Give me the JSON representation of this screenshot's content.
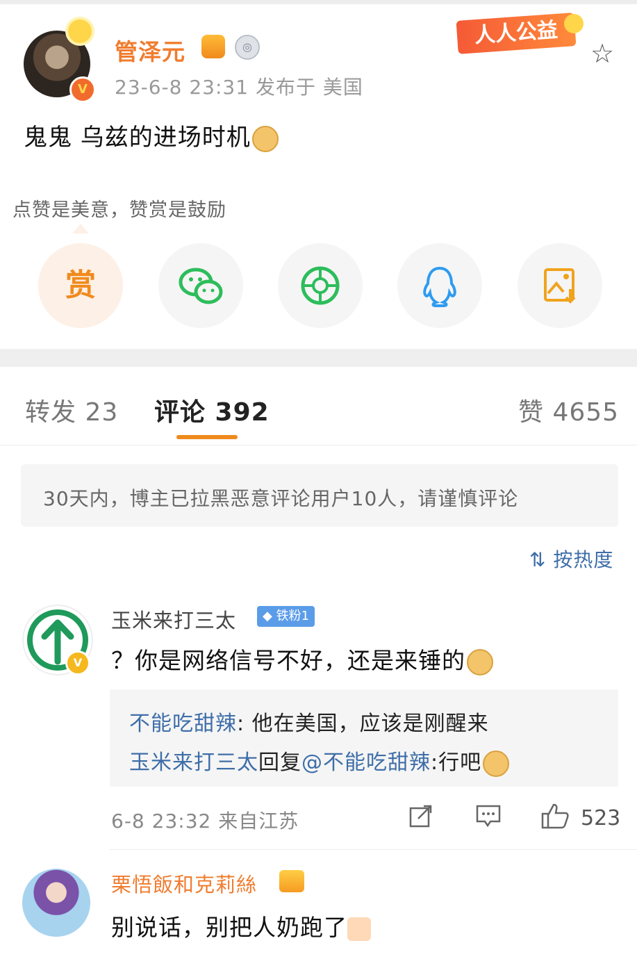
{
  "post": {
    "author": "管泽元",
    "time_location": "23-6-8 23:31  发布于 美国",
    "content": "鬼鬼 乌兹的进场时机",
    "charity_tag": "人人公益",
    "vip_letter": "V"
  },
  "reward_tip": "点赞是美意，赞赏是鼓励",
  "share_buttons": [
    {
      "icon": "reward-icon",
      "label": "赏"
    },
    {
      "icon": "wechat-icon"
    },
    {
      "icon": "moments-icon"
    },
    {
      "icon": "qq-icon"
    },
    {
      "icon": "save-image-icon"
    }
  ],
  "tabs": {
    "repost": "转发 23",
    "comments": "评论 392",
    "likes": "赞 4655"
  },
  "notice": "30天内，博主已拉黑恶意评论用户10人，请谨慎评论",
  "sort_label": "按热度",
  "comments": [
    {
      "user": "玉米来打三太",
      "fan_badge": "铁粉1",
      "vip_letter": "V",
      "text": "？你是网络信号不好，还是来锤的",
      "replies": [
        {
          "name": "不能吃甜辣",
          "sep": ": ",
          "text": "他在美国，应该是刚醒来"
        },
        {
          "name": "玉米来打三太",
          "mid": "回复",
          "mention": "@不能吃甜辣",
          "sep": ":",
          "text": "行吧"
        }
      ],
      "meta": "6-8 23:32  来自江苏",
      "likes": "523"
    },
    {
      "user": "栗悟飯和克莉絲",
      "text": "别说话，别把人奶跑了"
    }
  ],
  "colors": {
    "orange": "#f08a1d",
    "link_blue": "#3e6ea8",
    "wechat_green": "#2dbd5b",
    "qq_blue": "#2e9bf0"
  }
}
